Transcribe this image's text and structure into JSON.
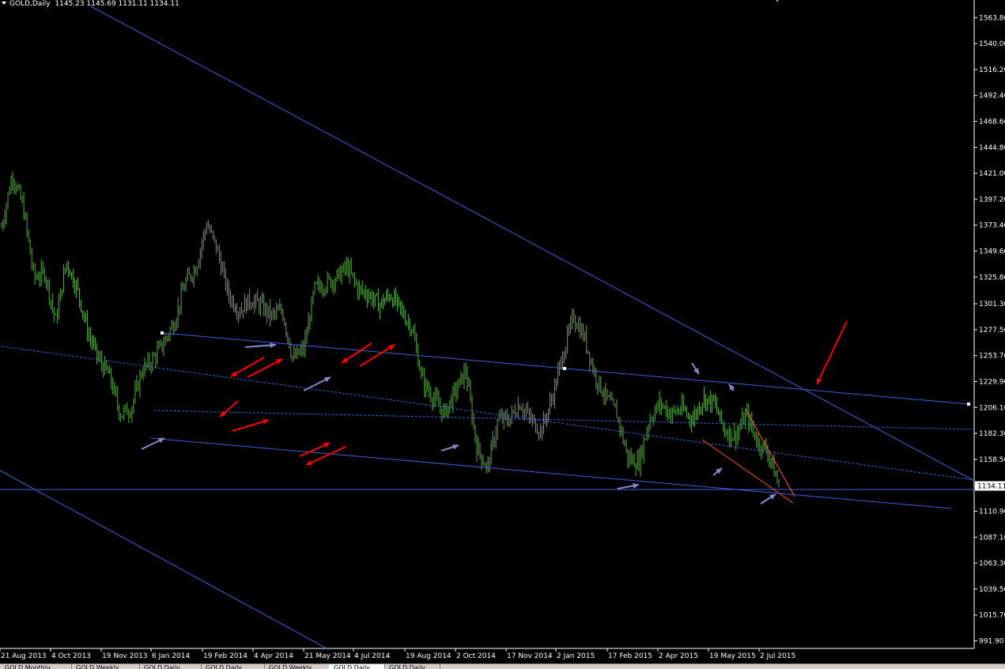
{
  "header": {
    "symbol": "GOLD,Daily",
    "ohlc": "1145.23 1145.69 1131.11 1134.11"
  },
  "tabs": [
    {
      "label": "GOLD,Monthly",
      "active": false
    },
    {
      "label": "GOLD,Weekly",
      "active": false
    },
    {
      "label": "GOLD,Daily",
      "active": false
    },
    {
      "label": "GOLD,Daily",
      "active": false
    },
    {
      "label": "GOLD,Weekly",
      "active": false
    },
    {
      "label": "GOLD,Daily",
      "active": true
    },
    {
      "label": "GOLD,Daily",
      "active": false
    }
  ],
  "colors": {
    "background": "#000000",
    "candles": "#5fa84a",
    "trendline": "#3f5fd8",
    "annotation_red": "#ff0000",
    "annotation_arrow": "#8888cc",
    "orange_line": "#ff5a1e",
    "axis_text": "#ffffff"
  },
  "chart_data": {
    "type": "line",
    "title": "GOLD,Daily",
    "current_price": 1134.11,
    "y_axis": {
      "ticks": [
        1563.8,
        1540.0,
        1516.2,
        1492.4,
        1468.6,
        1444.8,
        1421.0,
        1397.2,
        1373.4,
        1349.6,
        1325.8,
        1301.3,
        1277.5,
        1253.7,
        1229.9,
        1206.1,
        1182.3,
        1158.5,
        1134.11,
        1110.9,
        1087.1,
        1063.3,
        1039.5,
        1015.7,
        991.9
      ],
      "range": [
        985,
        1580
      ]
    },
    "x_axis": {
      "ticks": [
        "21 Aug 2013",
        "4 Oct 2013",
        "19 Nov 2013",
        "6 Jan 2014",
        "19 Feb 2014",
        "4 Apr 2014",
        "21 May 2014",
        "4 Jul 2014",
        "19 Aug 2014",
        "2 Oct 2014",
        "17 Nov 2014",
        "2 Jan 2015",
        "17 Feb 2015",
        "2 Apr 2015",
        "19 May 2015",
        "2 Jul 2015"
      ]
    },
    "series": [
      {
        "x": [
          "21 Aug 2013",
          "30 Aug 2013",
          "10 Sep 2013",
          "20 Sep 2013",
          "4 Oct 2013",
          "15 Oct 2013",
          "25 Oct 2013",
          "5 Nov 2013",
          "19 Nov 2013",
          "29 Nov 2013",
          "10 Dec 2013",
          "20 Dec 2013",
          "31 Dec 2013",
          "6 Jan 2014",
          "16 Jan 2014",
          "27 Jan 2014",
          "6 Feb 2014",
          "19 Feb 2014",
          "28 Feb 2014",
          "10 Mar 2014",
          "17 Mar 2014",
          "25 Mar 2014",
          "4 Apr 2014",
          "14 Apr 2014",
          "24 Apr 2014",
          "5 May 2014",
          "13 May 2014",
          "21 May 2014",
          "30 May 2014",
          "10 Jun 2014",
          "20 Jun 2014",
          "30 Jun 2014",
          "4 Jul 2014",
          "11 Jul 2014",
          "21 Jul 2014",
          "1 Aug 2014",
          "11 Aug 2014",
          "19 Aug 2014",
          "29 Aug 2014",
          "9 Sep 2014",
          "19 Sep 2014",
          "2 Oct 2014",
          "6 Oct 2014",
          "17 Oct 2014",
          "31 Oct 2014",
          "7 Nov 2014",
          "17 Nov 2014",
          "27 Nov 2014",
          "5 Dec 2014",
          "15 Dec 2014",
          "23 Dec 2014",
          "2 Jan 2015",
          "12 Jan 2015",
          "22 Jan 2015",
          "2 Feb 2015",
          "10 Feb 2015",
          "17 Feb 2015",
          "27 Feb 2015",
          "10 Mar 2015",
          "17 Mar 2015",
          "25 Mar 2015",
          "2 Apr 2015",
          "13 Apr 2015",
          "24 Apr 2015",
          "5 May 2015",
          "12 May 2015",
          "19 May 2015",
          "29 May 2015",
          "9 Jun 2015",
          "19 Jun 2015",
          "29 Jun 2015",
          "2 Jul 2015",
          "10 Jul 2015"
        ],
        "values": [
          1372,
          1420,
          1390,
          1325,
          1330,
          1285,
          1340,
          1315,
          1275,
          1250,
          1235,
          1200,
          1205,
          1240,
          1250,
          1265,
          1285,
          1320,
          1335,
          1375,
          1350,
          1310,
          1295,
          1305,
          1300,
          1290,
          1295,
          1250,
          1260,
          1315,
          1320,
          1325,
          1335,
          1315,
          1310,
          1300,
          1310,
          1295,
          1280,
          1230,
          1215,
          1200,
          1220,
          1240,
          1170,
          1150,
          1195,
          1195,
          1210,
          1195,
          1185,
          1215,
          1255,
          1290,
          1270,
          1235,
          1215,
          1200,
          1160,
          1155,
          1195,
          1210,
          1200,
          1205,
          1195,
          1215,
          1210,
          1185,
          1180,
          1200,
          1175,
          1165,
          1134
        ]
      }
    ]
  }
}
